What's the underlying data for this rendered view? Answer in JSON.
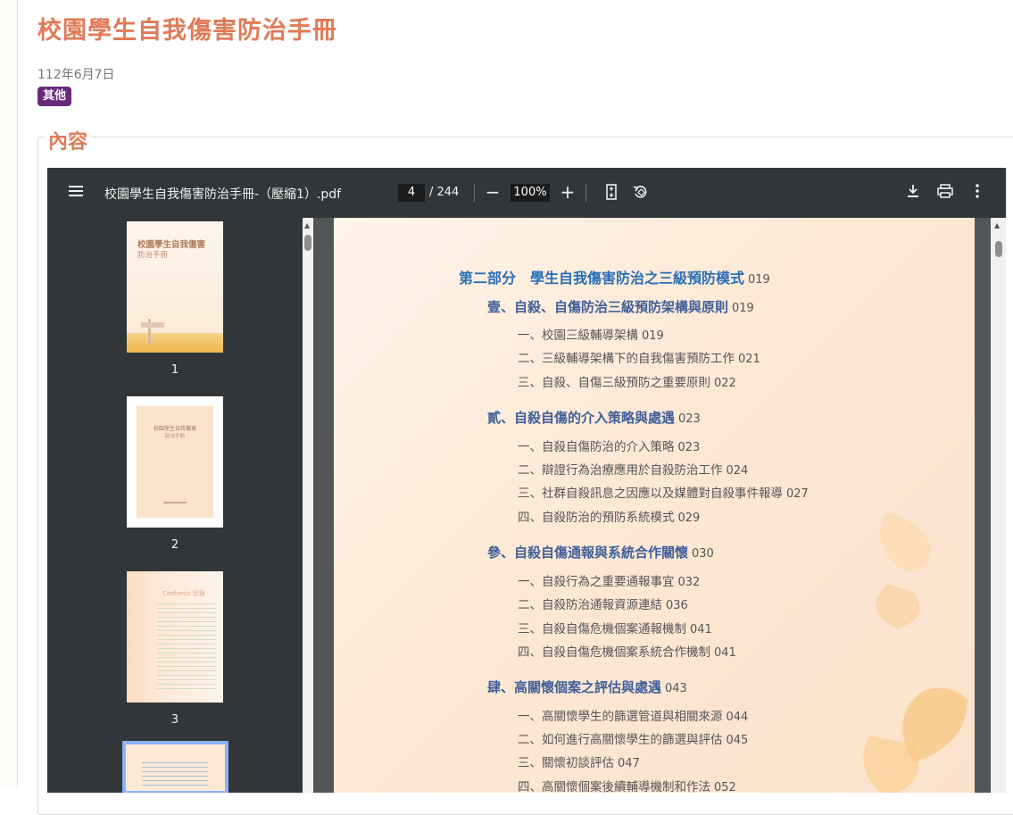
{
  "page_title": "校園學生自我傷害防治手冊",
  "date": "112年6月7日",
  "category_badge": "其他",
  "section_legend": "內容",
  "viewer": {
    "filename": "校園學生自我傷害防治手冊-（壓縮1）.pdf",
    "current_page": "4",
    "page_total": "/ 244",
    "zoom": "100%",
    "icons": [
      "menu-icon",
      "zoom-out-icon",
      "zoom-in-icon",
      "fit-page-icon",
      "rotate-icon",
      "download-icon",
      "print-icon",
      "more-vert-icon"
    ],
    "thumbnails": [
      {
        "number": "1",
        "title": "校園學生自我傷害",
        "subtitle": "防治手冊"
      },
      {
        "number": "2",
        "title": "校園學生自我傷害",
        "subtitle": "防治手冊"
      },
      {
        "number": "3",
        "title": "Contents 目錄"
      }
    ]
  },
  "toc": {
    "part": {
      "label": "第二部分　學生自我傷害防治之三級預防模式",
      "page": "019"
    },
    "chapters": [
      {
        "label": "壹、自殺、自傷防治三級預防架構與原則",
        "page": "019",
        "items": [
          {
            "label": "一、校園三級輔導架構",
            "page": "019"
          },
          {
            "label": "二、三級輔導架構下的自我傷害預防工作",
            "page": "021"
          },
          {
            "label": "三、自殺、自傷三級預防之重要原則",
            "page": "022"
          }
        ]
      },
      {
        "label": "貳、自殺自傷的介入策略與處遇",
        "page": "023",
        "items": [
          {
            "label": "一、自殺自傷防治的介入策略",
            "page": "023"
          },
          {
            "label": "二、辯證行為治療應用於自殺防治工作",
            "page": "024"
          },
          {
            "label": "三、社群自殺訊息之因應以及媒體對自殺事件報導",
            "page": "027"
          },
          {
            "label": "四、自殺防治的預防系統模式",
            "page": "029"
          }
        ]
      },
      {
        "label": "參、自殺自傷通報與系統合作關懷",
        "page": "030",
        "items": [
          {
            "label": "一、自殺行為之重要通報事宜",
            "page": "032"
          },
          {
            "label": "二、自殺防治通報資源連結",
            "page": "036"
          },
          {
            "label": "三、自殺自傷危機個案通報機制",
            "page": "041"
          },
          {
            "label": "四、自殺自傷危機個案系統合作機制",
            "page": "041"
          }
        ]
      },
      {
        "label": "肆、高關懷個案之評估與處遇",
        "page": "043",
        "items": [
          {
            "label": "一、高關懷學生的篩選管道與相關來源",
            "page": "044"
          },
          {
            "label": "二、如何進行高關懷學生的篩選與評估",
            "page": "045"
          },
          {
            "label": "三、關懷初談評估",
            "page": "047"
          },
          {
            "label": "四、高關懷個案後續輔導機制和作法",
            "page": "052"
          }
        ]
      }
    ]
  }
}
